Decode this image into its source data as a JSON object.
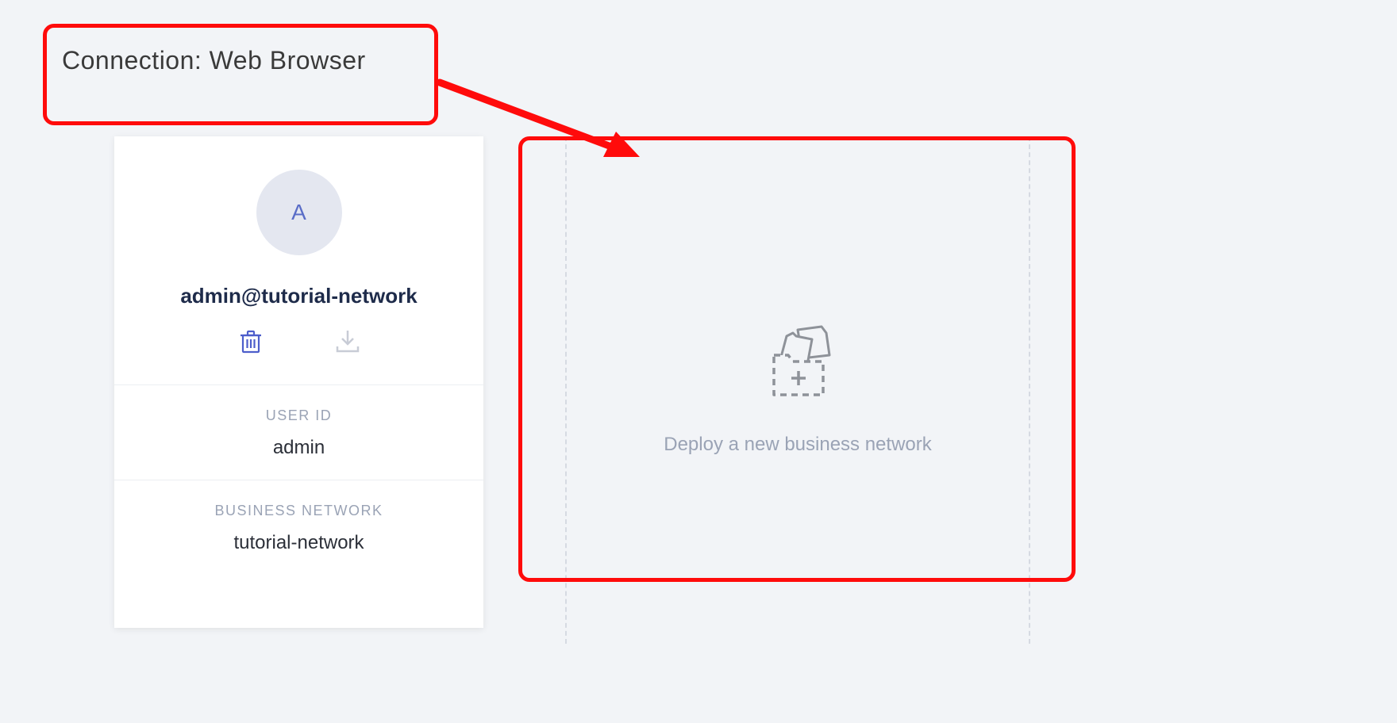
{
  "header": {
    "connection_label": "Connection: Web Browser"
  },
  "card": {
    "avatar_letter": "A",
    "identity": "admin@tutorial-network",
    "user_id_label": "USER ID",
    "user_id_value": "admin",
    "business_network_label": "BUSINESS NETWORK",
    "business_network_value": "tutorial-network"
  },
  "deploy": {
    "label": "Deploy a new business network"
  },
  "icons": {
    "trash": "trash-icon",
    "download": "download-icon",
    "deploy_folder": "deploy-folder-icon"
  },
  "colors": {
    "accent_blue": "#5a6dc7",
    "annotation_red": "#ff0b0b",
    "icon_gray": "#9aa3b5"
  }
}
